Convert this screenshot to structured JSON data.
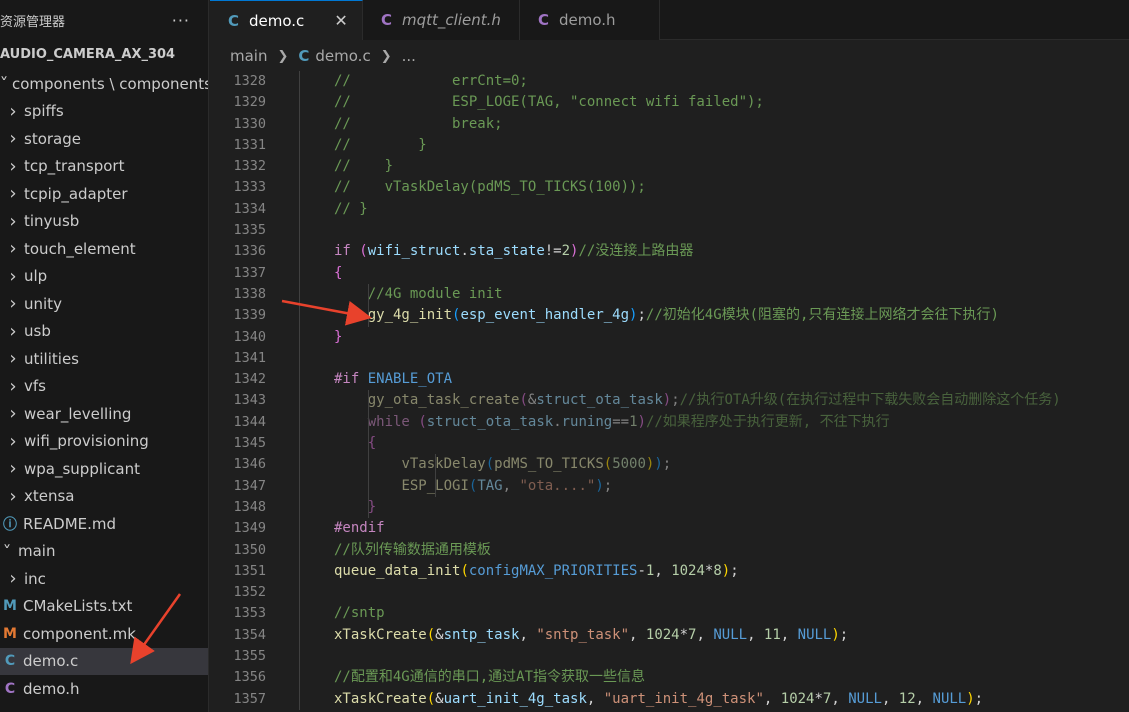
{
  "sidebar": {
    "title": "资源管理器",
    "more": "···",
    "project": "AUDIO_CAMERA_AX_304",
    "items": [
      {
        "label": "components \\ components",
        "kind": "folder-open",
        "indent": 0
      },
      {
        "label": "spiffs",
        "kind": "folder",
        "indent": 1
      },
      {
        "label": "storage",
        "kind": "folder",
        "indent": 1
      },
      {
        "label": "tcp_transport",
        "kind": "folder",
        "indent": 1
      },
      {
        "label": "tcpip_adapter",
        "kind": "folder",
        "indent": 1
      },
      {
        "label": "tinyusb",
        "kind": "folder",
        "indent": 1
      },
      {
        "label": "touch_element",
        "kind": "folder",
        "indent": 1
      },
      {
        "label": "ulp",
        "kind": "folder",
        "indent": 1
      },
      {
        "label": "unity",
        "kind": "folder",
        "indent": 1
      },
      {
        "label": "usb",
        "kind": "folder",
        "indent": 1
      },
      {
        "label": "utilities",
        "kind": "folder",
        "indent": 1
      },
      {
        "label": "vfs",
        "kind": "folder",
        "indent": 1
      },
      {
        "label": "wear_levelling",
        "kind": "folder",
        "indent": 1
      },
      {
        "label": "wifi_provisioning",
        "kind": "folder",
        "indent": 1
      },
      {
        "label": "wpa_supplicant",
        "kind": "folder",
        "indent": 1
      },
      {
        "label": "xtensa",
        "kind": "folder",
        "indent": 1
      },
      {
        "label": "README.md",
        "kind": "file",
        "icon": "ⓘ",
        "iconClass": "ic-info",
        "indent": 0
      },
      {
        "label": "main",
        "kind": "folder-open",
        "indent": 0
      },
      {
        "label": "inc",
        "kind": "folder",
        "indent": 1
      },
      {
        "label": "CMakeLists.txt",
        "kind": "file",
        "icon": "M",
        "iconClass": "ic-m",
        "indent": 0
      },
      {
        "label": "component.mk",
        "kind": "file",
        "icon": "M",
        "iconClass": "ic-mk",
        "indent": 0
      },
      {
        "label": "demo.c",
        "kind": "file",
        "icon": "C",
        "iconClass": "ic-c",
        "indent": 0,
        "active": true
      },
      {
        "label": "demo.h",
        "kind": "file",
        "icon": "C",
        "iconClass": "ic-h",
        "indent": 0
      },
      {
        "label": "",
        "kind": "file",
        "icon": "",
        "iconClass": "ic-c",
        "indent": 0
      }
    ]
  },
  "tabs": [
    {
      "label": "demo.c",
      "icon": "C",
      "iconClass": "ic-c",
      "active": true,
      "close": "✕"
    },
    {
      "label": "mqtt_client.h",
      "icon": "C",
      "iconClass": "ic-h",
      "italic": true
    },
    {
      "label": "demo.h",
      "icon": "C",
      "iconClass": "ic-h"
    }
  ],
  "breadcrumb": {
    "folder": "main",
    "file_icon": "C",
    "file": "demo.c",
    "tail": "..."
  },
  "colors": {
    "accent": "#0078d4",
    "annotation_arrow": "#e8422c"
  },
  "code_lines": [
    {
      "n": "1328",
      "tokens": [
        [
          "t-cm",
          "//            errCnt=0;"
        ]
      ]
    },
    {
      "n": "1329",
      "tokens": [
        [
          "t-cm",
          "//            ESP_LOGE(TAG, \"connect wifi failed\");"
        ]
      ]
    },
    {
      "n": "1330",
      "tokens": [
        [
          "t-cm",
          "//            break;"
        ]
      ]
    },
    {
      "n": "1331",
      "tokens": [
        [
          "t-cm",
          "//        }"
        ]
      ]
    },
    {
      "n": "1332",
      "tokens": [
        [
          "t-cm",
          "//    }"
        ]
      ]
    },
    {
      "n": "1333",
      "tokens": [
        [
          "t-cm",
          "//    vTaskDelay(pdMS_TO_TICKS(100));"
        ]
      ]
    },
    {
      "n": "1334",
      "tokens": [
        [
          "t-cm",
          "// }"
        ]
      ]
    },
    {
      "n": "1335",
      "tokens": []
    },
    {
      "n": "1336",
      "tokens": [
        [
          "t-ctl",
          "if"
        ],
        [
          "t-plain",
          " "
        ],
        [
          "t-br2",
          "("
        ],
        [
          "t-var",
          "wifi_struct"
        ],
        [
          "t-plain",
          "."
        ],
        [
          "t-var",
          "sta_state"
        ],
        [
          "t-plain",
          "!="
        ],
        [
          "t-num",
          "2"
        ],
        [
          "t-br2",
          ")"
        ],
        [
          "t-cm",
          "//没连接上路由器"
        ]
      ]
    },
    {
      "n": "1337",
      "tokens": [
        [
          "t-br2",
          "{"
        ]
      ]
    },
    {
      "n": "1338",
      "tokens": [
        [
          "t-plain",
          "    "
        ],
        [
          "t-cm",
          "//4G module init"
        ]
      ]
    },
    {
      "n": "1339",
      "tokens": [
        [
          "t-plain",
          "    "
        ],
        [
          "t-fn",
          "gy_4g_init"
        ],
        [
          "t-br3",
          "("
        ],
        [
          "t-var",
          "esp_event_handler_4g"
        ],
        [
          "t-br3",
          ")"
        ],
        [
          "t-plain",
          ";"
        ],
        [
          "t-cm",
          "//初始化4G模块(阻塞的,只有连接上网络才会往下执行)"
        ]
      ]
    },
    {
      "n": "1340",
      "tokens": [
        [
          "t-br2",
          "}"
        ]
      ]
    },
    {
      "n": "1341",
      "tokens": []
    },
    {
      "n": "1342",
      "tokens": [
        [
          "t-ctl",
          "#if"
        ],
        [
          "t-plain",
          " "
        ],
        [
          "t-mac",
          "ENABLE_OTA"
        ]
      ]
    },
    {
      "n": "1343",
      "dim": true,
      "tokens": [
        [
          "t-plain",
          "    "
        ],
        [
          "t-fn",
          "gy_ota_task_create"
        ],
        [
          "t-br2",
          "("
        ],
        [
          "t-plain",
          "&"
        ],
        [
          "t-var",
          "struct_ota_task"
        ],
        [
          "t-br2",
          ")"
        ],
        [
          "t-plain",
          ";"
        ],
        [
          "t-cm",
          "//执行OTA升级(在执行过程中下载失败会自动删除这个任务)"
        ]
      ]
    },
    {
      "n": "1344",
      "dim": true,
      "tokens": [
        [
          "t-plain",
          "    "
        ],
        [
          "t-ctl",
          "while"
        ],
        [
          "t-plain",
          " "
        ],
        [
          "t-br2",
          "("
        ],
        [
          "t-var",
          "struct_ota_task"
        ],
        [
          "t-plain",
          "."
        ],
        [
          "t-var",
          "runing"
        ],
        [
          "t-plain",
          "=="
        ],
        [
          "t-num",
          "1"
        ],
        [
          "t-br2",
          ")"
        ],
        [
          "t-cm",
          "//如果程序处于执行更新, 不往下执行"
        ]
      ]
    },
    {
      "n": "1345",
      "dim": true,
      "tokens": [
        [
          "t-plain",
          "    "
        ],
        [
          "t-br2",
          "{"
        ]
      ]
    },
    {
      "n": "1346",
      "dim": true,
      "tokens": [
        [
          "t-plain",
          "        "
        ],
        [
          "t-fn",
          "vTaskDelay"
        ],
        [
          "t-br3",
          "("
        ],
        [
          "t-fn",
          "pdMS_TO_TICKS"
        ],
        [
          "t-br1",
          "("
        ],
        [
          "t-num",
          "5000"
        ],
        [
          "t-br1",
          ")"
        ],
        [
          "t-br3",
          ")"
        ],
        [
          "t-plain",
          ";"
        ]
      ]
    },
    {
      "n": "1347",
      "dim": true,
      "tokens": [
        [
          "t-plain",
          "        "
        ],
        [
          "t-fn",
          "ESP_LOGI"
        ],
        [
          "t-br3",
          "("
        ],
        [
          "t-var",
          "TAG"
        ],
        [
          "t-plain",
          ", "
        ],
        [
          "t-str",
          "\"ota....\""
        ],
        [
          "t-br3",
          ")"
        ],
        [
          "t-plain",
          ";"
        ]
      ]
    },
    {
      "n": "1348",
      "dim": true,
      "tokens": [
        [
          "t-plain",
          "    "
        ],
        [
          "t-br2",
          "}"
        ]
      ]
    },
    {
      "n": "1349",
      "tokens": [
        [
          "t-ctl",
          "#endif"
        ]
      ]
    },
    {
      "n": "1350",
      "tokens": [
        [
          "t-cm",
          "//队列传输数据通用模板"
        ]
      ]
    },
    {
      "n": "1351",
      "tokens": [
        [
          "t-fn",
          "queue_data_init"
        ],
        [
          "t-br1",
          "("
        ],
        [
          "t-mac",
          "configMAX_PRIORITIES"
        ],
        [
          "t-plain",
          "-"
        ],
        [
          "t-num",
          "1"
        ],
        [
          "t-plain",
          ", "
        ],
        [
          "t-num",
          "1024"
        ],
        [
          "t-plain",
          "*"
        ],
        [
          "t-num",
          "8"
        ],
        [
          "t-br1",
          ")"
        ],
        [
          "t-plain",
          ";"
        ]
      ]
    },
    {
      "n": "1352",
      "tokens": []
    },
    {
      "n": "1353",
      "tokens": [
        [
          "t-cm",
          "//sntp"
        ]
      ]
    },
    {
      "n": "1354",
      "tokens": [
        [
          "t-fn",
          "xTaskCreate"
        ],
        [
          "t-br1",
          "("
        ],
        [
          "t-plain",
          "&"
        ],
        [
          "t-var",
          "sntp_task"
        ],
        [
          "t-plain",
          ", "
        ],
        [
          "t-str",
          "\"sntp_task\""
        ],
        [
          "t-plain",
          ", "
        ],
        [
          "t-num",
          "1024"
        ],
        [
          "t-plain",
          "*"
        ],
        [
          "t-num",
          "7"
        ],
        [
          "t-plain",
          ", "
        ],
        [
          "t-kw",
          "NULL"
        ],
        [
          "t-plain",
          ", "
        ],
        [
          "t-num",
          "11"
        ],
        [
          "t-plain",
          ", "
        ],
        [
          "t-kw",
          "NULL"
        ],
        [
          "t-br1",
          ")"
        ],
        [
          "t-plain",
          ";"
        ]
      ]
    },
    {
      "n": "1355",
      "tokens": []
    },
    {
      "n": "1356",
      "tokens": [
        [
          "t-cm",
          "//配置和4G通信的串口,通过AT指令获取一些信息"
        ]
      ]
    },
    {
      "n": "1357",
      "tokens": [
        [
          "t-fn",
          "xTaskCreate"
        ],
        [
          "t-br1",
          "("
        ],
        [
          "t-plain",
          "&"
        ],
        [
          "t-var",
          "uart_init_4g_task"
        ],
        [
          "t-plain",
          ", "
        ],
        [
          "t-str",
          "\"uart_init_4g_task\""
        ],
        [
          "t-plain",
          ", "
        ],
        [
          "t-num",
          "1024"
        ],
        [
          "t-plain",
          "*"
        ],
        [
          "t-num",
          "7"
        ],
        [
          "t-plain",
          ", "
        ],
        [
          "t-kw",
          "NULL"
        ],
        [
          "t-plain",
          ", "
        ],
        [
          "t-num",
          "12"
        ],
        [
          "t-plain",
          ", "
        ],
        [
          "t-kw",
          "NULL"
        ],
        [
          "t-br1",
          ")"
        ],
        [
          "t-plain",
          ";"
        ]
      ]
    }
  ]
}
